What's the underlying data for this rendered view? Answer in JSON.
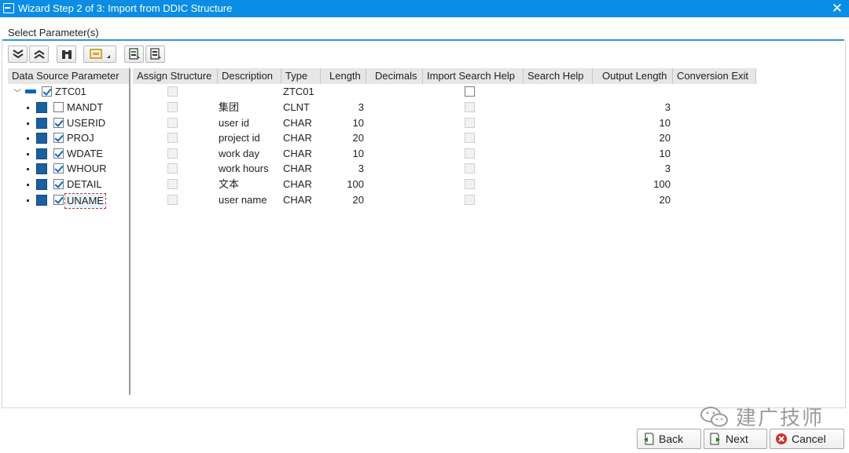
{
  "window": {
    "title": "Wizard Step 2 of 3: Import from DDIC Structure",
    "close_glyph": "✕"
  },
  "group": {
    "label": "Select Parameter(s)"
  },
  "toolbar": {
    "buttons": [
      {
        "icon": "expand-all-icon"
      },
      {
        "icon": "collapse-all-icon"
      },
      {
        "icon": "find-icon"
      },
      {
        "icon": "structure-menu-icon"
      },
      {
        "icon": "select-block-icon"
      },
      {
        "icon": "deselect-block-icon"
      }
    ]
  },
  "columns": {
    "tree": "Data Source Parameter",
    "assign_structure": "Assign Structure",
    "description": "Description",
    "type": "Type",
    "length": "Length",
    "decimals": "Decimals",
    "import_search_help": "Import Search Help",
    "search_help": "Search Help",
    "output_length": "Output Length",
    "conversion_exit": "Conversion Exit"
  },
  "root": {
    "name": "ZTC01",
    "type": "ZTC01",
    "checked": true
  },
  "rows": [
    {
      "name": "MANDT",
      "checked": false,
      "description": "集团",
      "type": "CLNT",
      "length": "3",
      "output_length": "3"
    },
    {
      "name": "USERID",
      "checked": true,
      "description": "user id",
      "type": "CHAR",
      "length": "10",
      "output_length": "10"
    },
    {
      "name": "PROJ",
      "checked": true,
      "description": "project id",
      "type": "CHAR",
      "length": "20",
      "output_length": "20"
    },
    {
      "name": "WDATE",
      "checked": true,
      "description": "work day",
      "type": "CHAR",
      "length": "10",
      "output_length": "10"
    },
    {
      "name": "WHOUR",
      "checked": true,
      "description": "work hours",
      "type": "CHAR",
      "length": "3",
      "output_length": "3"
    },
    {
      "name": "DETAIL",
      "checked": true,
      "description": "文本",
      "type": "CHAR",
      "length": "100",
      "output_length": "100"
    },
    {
      "name": "UNAME",
      "checked": true,
      "description": "user name",
      "type": "CHAR",
      "length": "20",
      "output_length": "20"
    }
  ],
  "watermark": {
    "text": "建广技师"
  },
  "footer": {
    "back": "Back",
    "next": "Next",
    "cancel": "Cancel"
  },
  "colors": {
    "titlebar": "#0a8de4",
    "accent_line": "#3592d6",
    "cancel_icon": "#d0312d"
  }
}
